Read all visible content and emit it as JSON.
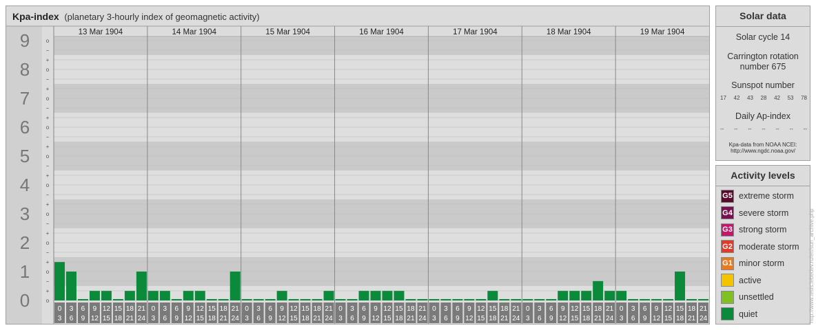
{
  "header": {
    "title": "Kpa-index",
    "subtitle": "(planetary 3-hourly index of geomagnetic activity)"
  },
  "solar": {
    "heading": "Solar data",
    "cycle": "Solar cycle 14",
    "carrington_line1": "Carrington rotation",
    "carrington_line2": "number 675",
    "sunspot_label": "Sunspot number",
    "sunspots": [
      "17",
      "42",
      "43",
      "28",
      "42",
      "53",
      "78"
    ],
    "ap_label": "Daily Ap-index",
    "ap_values": [
      "--",
      "--",
      "--",
      "--",
      "--",
      "--",
      "--"
    ],
    "source_line1": "Kpa-data from NOAA NCEI:",
    "source_line2": "http://www.ngdc.noaa.gov/"
  },
  "activity": {
    "heading": "Activity levels",
    "levels": [
      {
        "code": "G5",
        "label": "extreme storm",
        "color": "#5a0a2e"
      },
      {
        "code": "G4",
        "label": "severe storm",
        "color": "#7a1050"
      },
      {
        "code": "G3",
        "label": "strong storm",
        "color": "#c0186a"
      },
      {
        "code": "G2",
        "label": "moderate storm",
        "color": "#e03a2a"
      },
      {
        "code": "G1",
        "label": "minor storm",
        "color": "#e87a20"
      },
      {
        "code": "",
        "label": "active",
        "color": "#f5c400"
      },
      {
        "code": "",
        "label": "unsettled",
        "color": "#80c020"
      },
      {
        "code": "",
        "label": "quiet",
        "color": "#0a8a3a"
      }
    ]
  },
  "credit": "http://www.tesis.lebedev.ru/en/sun_archive.php",
  "chart_data": {
    "type": "bar",
    "y_axis_labels": [
      "0",
      "1",
      "2",
      "3",
      "4",
      "5",
      "6",
      "7",
      "8",
      "9"
    ],
    "sub_ticks": [
      "+",
      "o",
      "−"
    ],
    "ylim": [
      0,
      9.67
    ],
    "days": [
      "13 Mar 1904",
      "14 Mar 1904",
      "15 Mar 1904",
      "16 Mar 1904",
      "17 Mar 1904",
      "18 Mar 1904",
      "19 Mar 1904"
    ],
    "interval_labels": [
      [
        "0",
        "3"
      ],
      [
        "3",
        "6"
      ],
      [
        "6",
        "9"
      ],
      [
        "9",
        "12"
      ],
      [
        "12",
        "15"
      ],
      [
        "15",
        "18"
      ],
      [
        "18",
        "21"
      ],
      [
        "21",
        "24"
      ]
    ],
    "values": [
      [
        1.33,
        1.0,
        0.0,
        0.33,
        0.33,
        0.0,
        0.33,
        1.0
      ],
      [
        0.33,
        0.33,
        0.0,
        0.33,
        0.33,
        0.0,
        0.0,
        1.0
      ],
      [
        0.0,
        0.0,
        0.0,
        0.33,
        0.0,
        0.0,
        0.0,
        0.33
      ],
      [
        0.0,
        0.0,
        0.33,
        0.33,
        0.33,
        0.33,
        0.0,
        0.0
      ],
      [
        0.0,
        0.0,
        0.0,
        0.0,
        0.0,
        0.33,
        0.0,
        0.0
      ],
      [
        0.0,
        0.0,
        0.0,
        0.33,
        0.33,
        0.33,
        0.67,
        0.33
      ],
      [
        0.33,
        0.0,
        0.0,
        0.0,
        0.0,
        1.0,
        0.0,
        0.0
      ]
    ],
    "bar_color": "#0a8a3a",
    "grid": true
  }
}
